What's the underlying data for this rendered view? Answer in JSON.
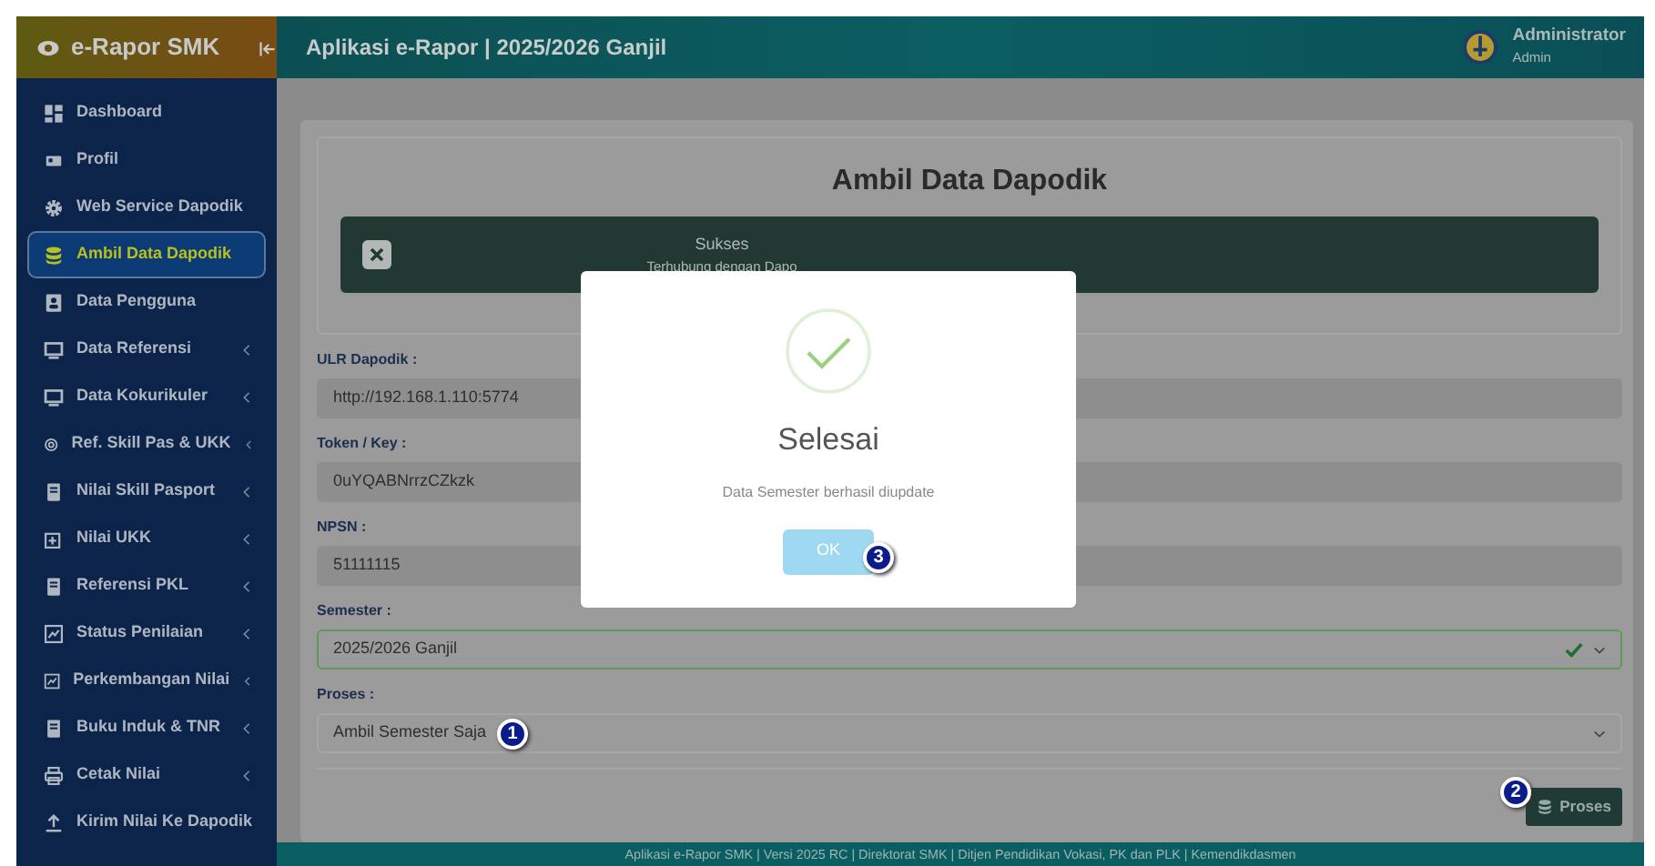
{
  "app": {
    "brand": "e-Rapor SMK",
    "header_title": "Aplikasi e-Rapor | 2025/2026 Ganjil",
    "user": {
      "name": "Administrator",
      "role": "Admin"
    }
  },
  "sidebar": {
    "items": [
      {
        "label": "Dashboard",
        "kind": "grid",
        "expandable": false,
        "selected": false
      },
      {
        "label": "Profil",
        "kind": "card",
        "expandable": false,
        "selected": false
      },
      {
        "label": "Web Service Dapodik",
        "kind": "gear",
        "expandable": false,
        "selected": false
      },
      {
        "label": "Ambil Data Dapodik",
        "kind": "database",
        "expandable": false,
        "selected": true
      },
      {
        "label": "Data Pengguna",
        "kind": "user",
        "expandable": false,
        "selected": false
      },
      {
        "label": "Data Referensi",
        "kind": "monitor",
        "expandable": true,
        "selected": false
      },
      {
        "label": "Data Kokurikuler",
        "kind": "monitor",
        "expandable": true,
        "selected": false
      },
      {
        "label": "Ref. Skill Pas & UKK",
        "kind": "target",
        "expandable": true,
        "selected": false
      },
      {
        "label": "Nilai Skill Pasport",
        "kind": "doc",
        "expandable": true,
        "selected": false
      },
      {
        "label": "Nilai UKK",
        "kind": "plus",
        "expandable": true,
        "selected": false
      },
      {
        "label": "Referensi PKL",
        "kind": "doc",
        "expandable": true,
        "selected": false
      },
      {
        "label": "Status Penilaian",
        "kind": "chart",
        "expandable": true,
        "selected": false
      },
      {
        "label": "Perkembangan Nilai",
        "kind": "chart",
        "expandable": true,
        "selected": false
      },
      {
        "label": "Buku Induk & TNR",
        "kind": "doc",
        "expandable": true,
        "selected": false
      },
      {
        "label": "Cetak Nilai",
        "kind": "printer",
        "expandable": true,
        "selected": false
      },
      {
        "label": "Kirim Nilai Ke Dapodik",
        "kind": "upload",
        "expandable": false,
        "selected": false
      }
    ]
  },
  "page": {
    "title": "Ambil Data Dapodik",
    "alert": {
      "title": "Sukses",
      "message": "Terhubung dengan Dapo"
    },
    "fields": [
      {
        "label": "ULR Dapodik :",
        "kind": "input",
        "value": "http://192.168.1.110:5774"
      },
      {
        "label": "Token / Key :",
        "kind": "input",
        "value": "0uYQABNrrzCZkzk"
      },
      {
        "label": "NPSN :",
        "kind": "input",
        "value": "51111115"
      },
      {
        "label": "Semester :",
        "kind": "select",
        "value": "2025/2026 Ganjil",
        "valid": true
      },
      {
        "label": "Proses :",
        "kind": "select",
        "value": "Ambil Semester Saja",
        "valid": false,
        "marker": "1"
      }
    ],
    "submit": {
      "label": "Proses",
      "marker": "2"
    }
  },
  "modal": {
    "title": "Selesai",
    "message": "Data Semester berhasil diupdate",
    "button": "OK",
    "marker": "3"
  },
  "footer": "Aplikasi e-Rapor SMK | Versi 2025 RC | Direktorat SMK | Ditjen Pendidikan Vokasi, PK dan PLK | Kemendikdasmen"
}
